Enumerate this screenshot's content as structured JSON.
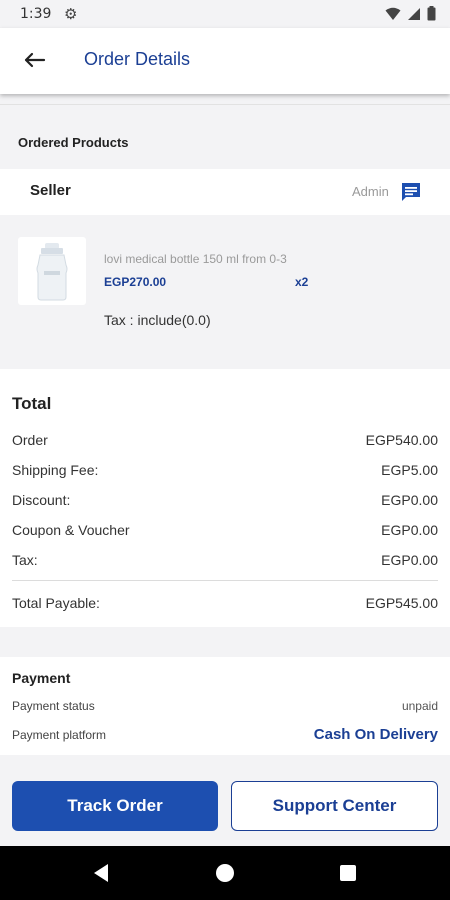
{
  "status_bar": {
    "time": "1:39",
    "settings_icon": "gear-icon",
    "wifi_icon": "wifi-icon",
    "signal_icon": "signal-icon",
    "battery_icon": "battery-icon"
  },
  "app_bar": {
    "title": "Order Details",
    "back_icon": "arrow-left-icon"
  },
  "ordered_products": {
    "heading": "Ordered Products"
  },
  "seller": {
    "label": "Seller",
    "name": "Admin",
    "chat_icon": "chat-icon"
  },
  "product": {
    "name": "lovi medical bottle 150 ml from 0-3",
    "price": "EGP270.00",
    "quantity": "x2",
    "tax_label": "Tax :",
    "tax_value": "include(0.0)"
  },
  "total": {
    "title": "Total",
    "rows": [
      {
        "label": "Order",
        "value": "EGP540.00"
      },
      {
        "label": "Shipping Fee:",
        "value": "EGP5.00"
      },
      {
        "label": "Discount:",
        "value": "EGP0.00"
      },
      {
        "label": "Coupon & Voucher",
        "value": "EGP0.00"
      },
      {
        "label": "Tax:",
        "value": "EGP0.00"
      }
    ],
    "payable_label": "Total Payable:",
    "payable_value": "EGP545.00"
  },
  "payment": {
    "title": "Payment",
    "status_label": "Payment status",
    "status_value": "unpaid",
    "platform_label": "Payment platform",
    "platform_value": "Cash On Delivery"
  },
  "actions": {
    "track_label": "Track Order",
    "support_label": "Support Center"
  },
  "colors": {
    "brand": "#1b3f94",
    "button": "#1d4fb0",
    "background": "#f3f3f5"
  }
}
